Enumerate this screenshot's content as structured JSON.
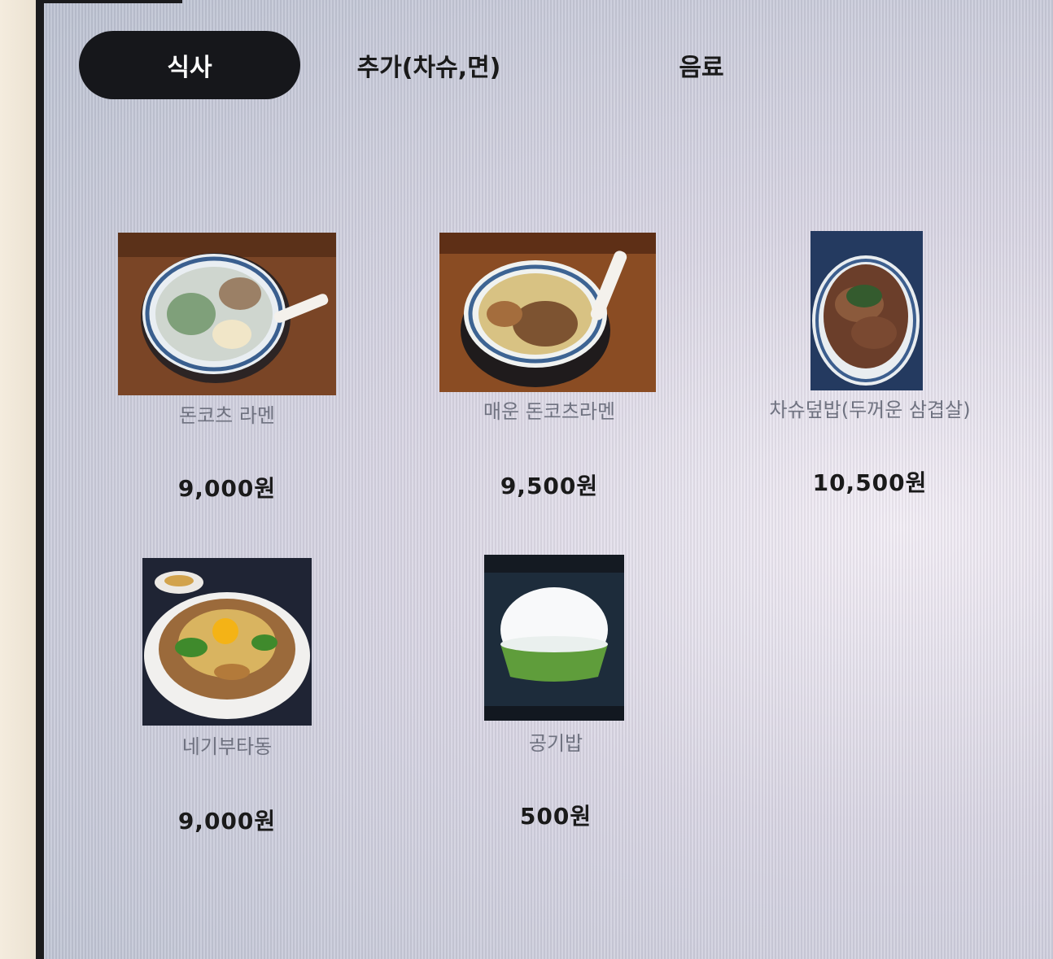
{
  "tabs": [
    {
      "label": "식사",
      "active": true
    },
    {
      "label": "추가(차슈,면)",
      "active": false
    },
    {
      "label": "음료",
      "active": false
    }
  ],
  "menu": [
    {
      "name": "돈코츠 라멘",
      "price": "9,000원",
      "image": "tonkotsu-ramen-photo"
    },
    {
      "name": "매운 돈코츠라멘",
      "price": "9,500원",
      "image": "spicy-tonkotsu-ramen-photo"
    },
    {
      "name": "차슈덮밥(두꺼운 삼겹살)",
      "price": "10,500원",
      "image": "chashu-rice-bowl-photo"
    },
    {
      "name": "네기부타동",
      "price": "9,000원",
      "image": "negi-butadon-photo"
    },
    {
      "name": "공기밥",
      "price": "500원",
      "image": "rice-bowl-photo"
    }
  ],
  "colors": {
    "active_tab_bg": "#16171b",
    "item_name": "#6f7280",
    "price": "#1a1a1a"
  }
}
